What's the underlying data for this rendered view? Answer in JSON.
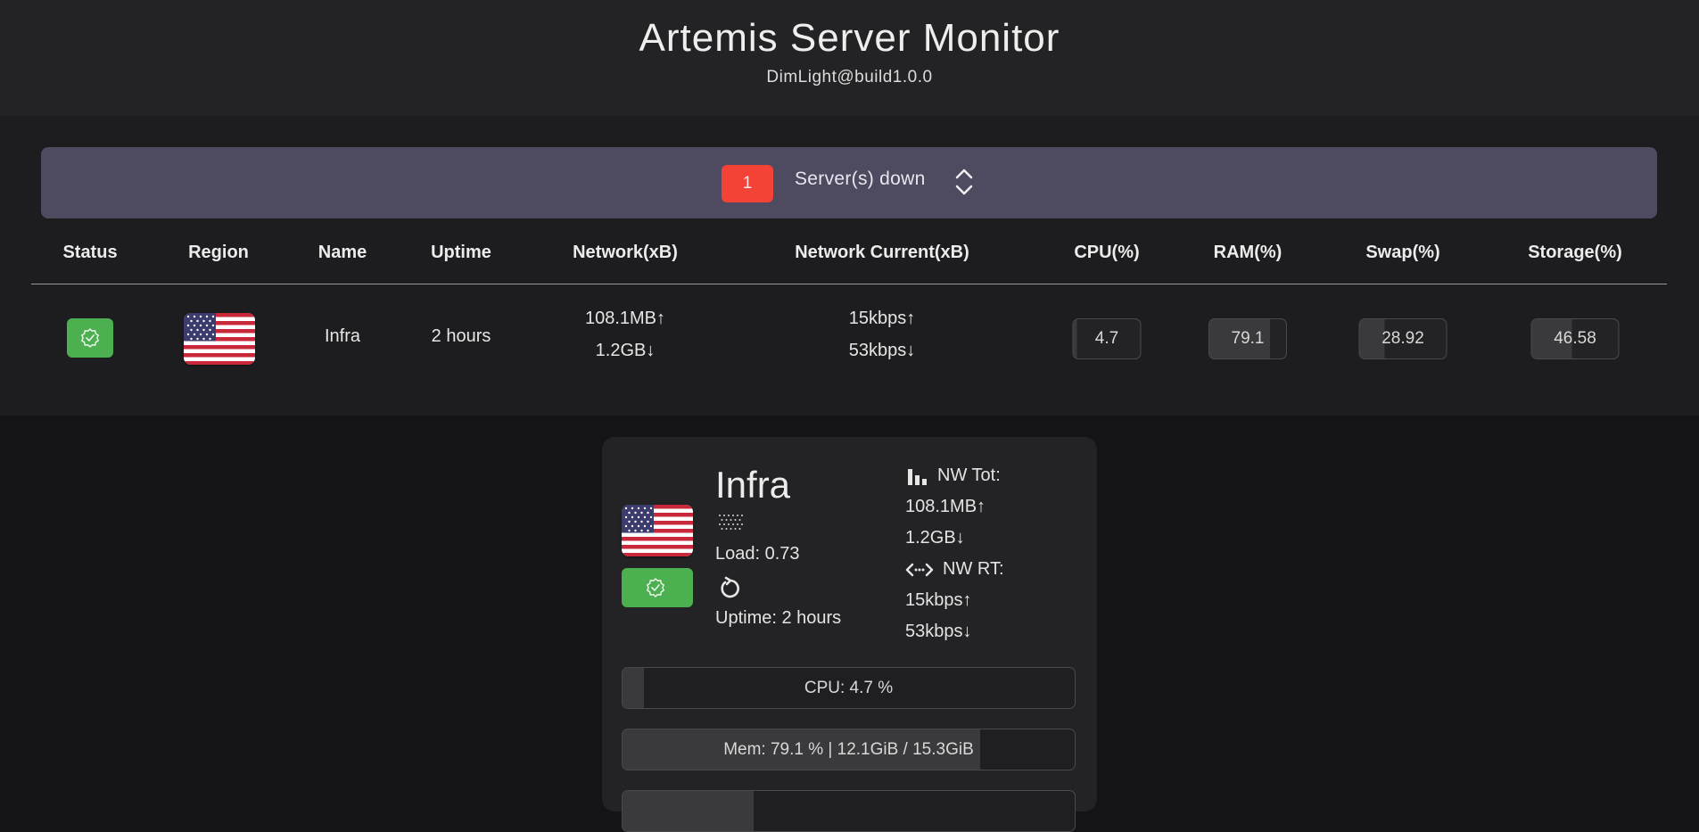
{
  "header": {
    "title": "Artemis Server Monitor",
    "subtitle": "DimLight@build1.0.0"
  },
  "alert": {
    "count": "1",
    "text": "Server(s) down",
    "color": "#f44336"
  },
  "table": {
    "columns": [
      "Status",
      "Region",
      "Name",
      "Uptime",
      "Network(xB)",
      "Network Current(xB)",
      "CPU(%)",
      "RAM(%)",
      "Swap(%)",
      "Storage(%)"
    ],
    "rows": [
      {
        "status": "online",
        "status_icon": "verified-badge-icon",
        "region_icon": "us-flag-icon",
        "name": "Infra",
        "uptime": "2 hours",
        "network_up": "108.1MB↑",
        "network_down": "1.2GB↓",
        "current_up": "15kbps↑",
        "current_down": "53kbps↓",
        "cpu": "4.7",
        "ram": "79.1",
        "swap": "28.92",
        "storage": "46.58"
      }
    ]
  },
  "card": {
    "name": "Infra",
    "region_icon": "us-flag-icon",
    "load": "Load: 0.73",
    "uptime": "Uptime: 2 hours",
    "nw_tot_label": "NW Tot:",
    "nw_tot_up": "108.1MB↑",
    "nw_tot_down": "1.2GB↓",
    "nw_rt_label": "NW RT:",
    "nw_rt_up": "15kbps↑",
    "nw_rt_down": "53kbps↓",
    "cpu_text": "CPU: 4.7 %",
    "cpu_percent": 4.7,
    "mem_text": "Mem: 79.1 % | 12.1GiB / 15.3GiB",
    "mem_percent": 79.1,
    "swap_percent": 28.92
  },
  "colors": {
    "ok_green": "#4caf50",
    "alert_bar": "#4e4a60",
    "background": "#141416"
  }
}
